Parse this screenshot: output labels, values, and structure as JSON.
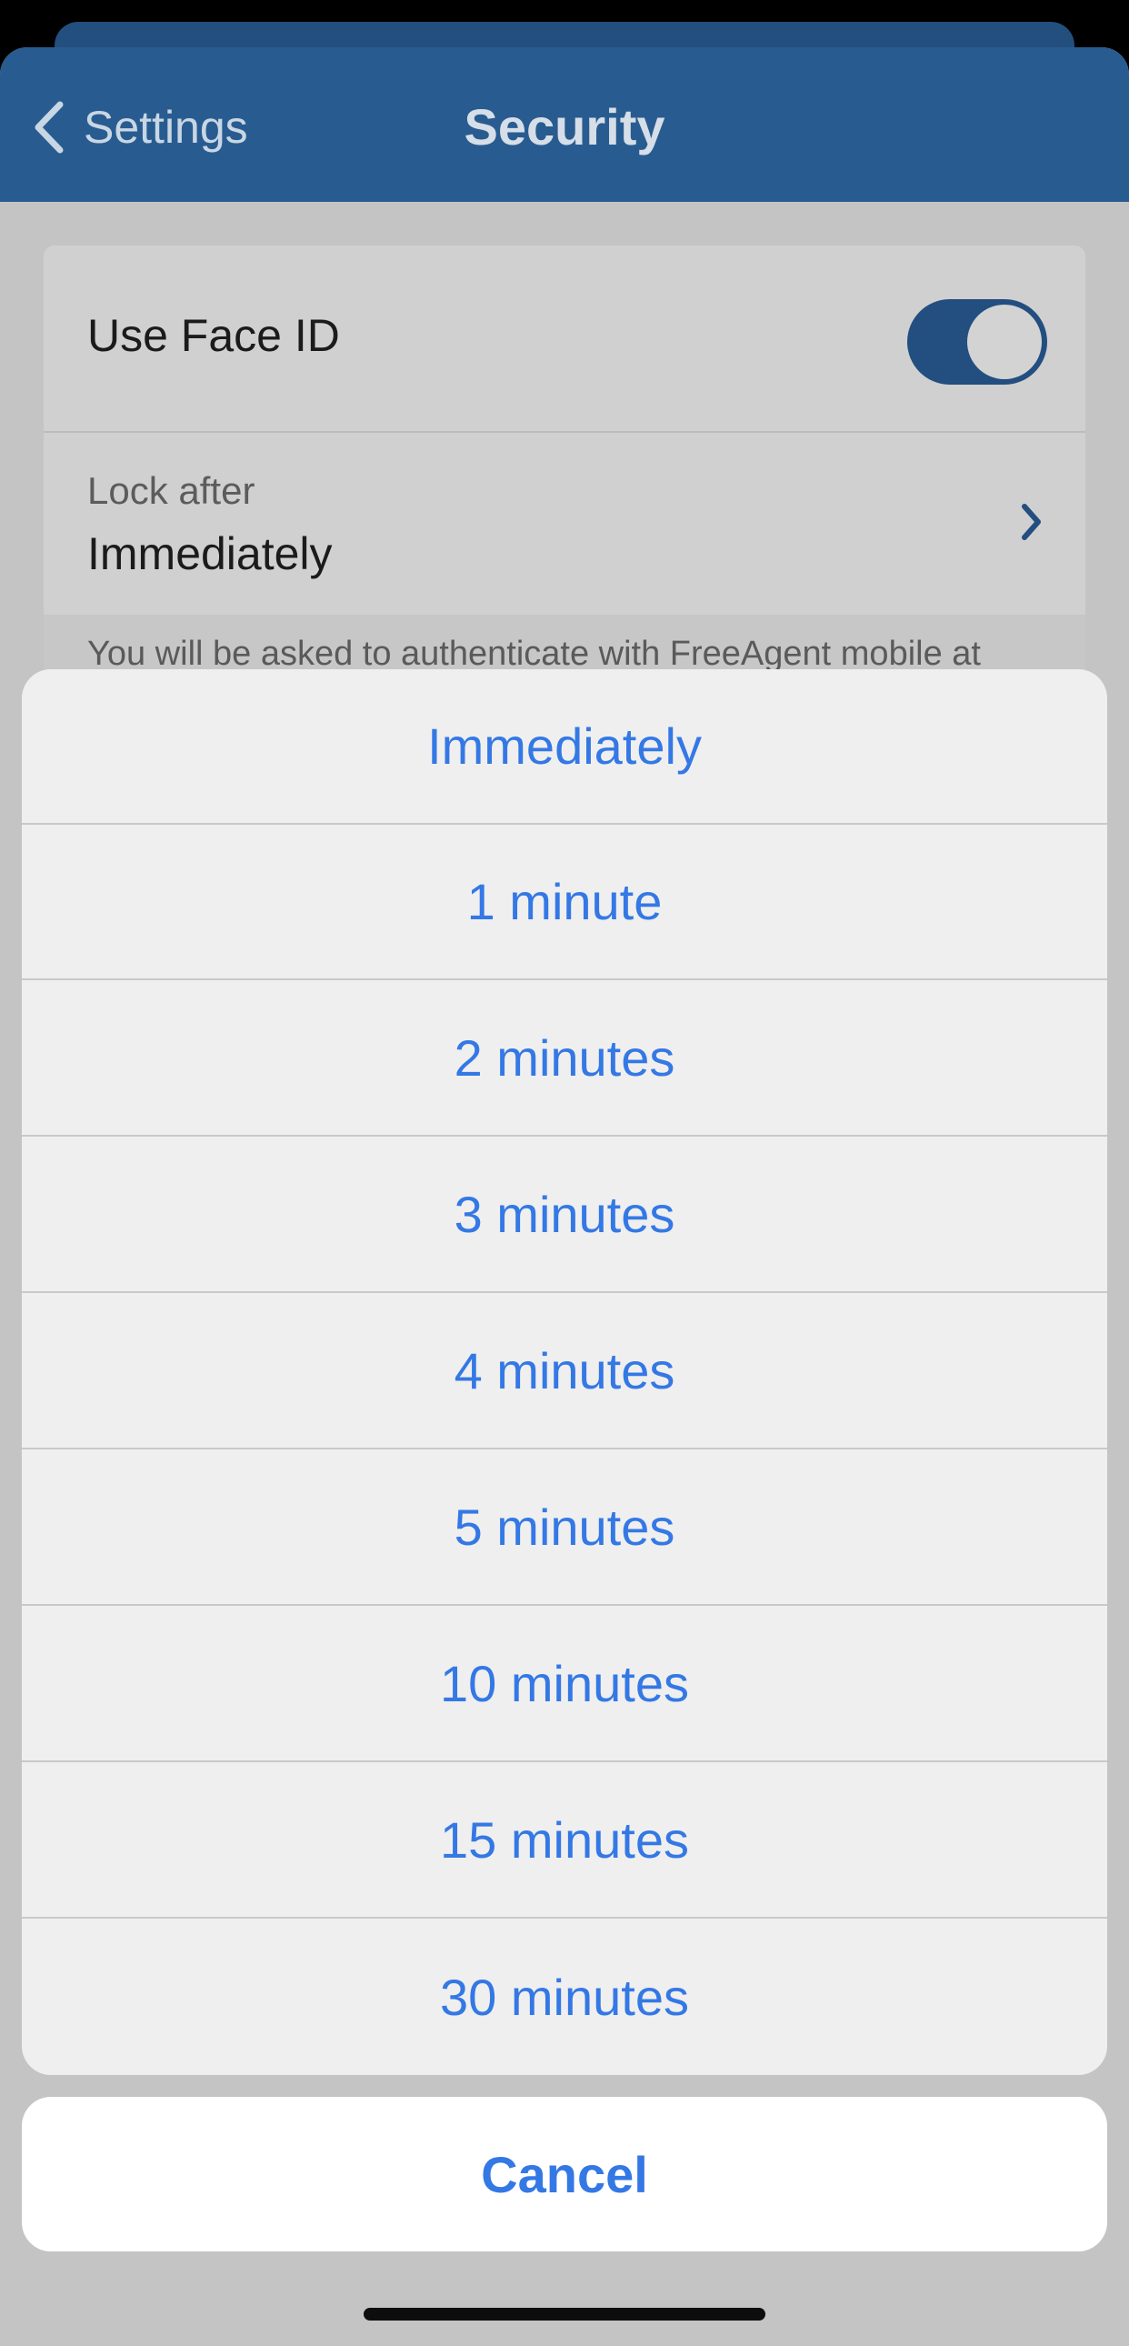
{
  "nav": {
    "back_label": "Settings",
    "title": "Security"
  },
  "settings": {
    "face_id_label": "Use Face ID",
    "face_id_enabled": true,
    "lock_after_caption": "Lock after",
    "lock_after_value": "Immediately",
    "footnote": "You will be asked to authenticate with FreeAgent mobile at"
  },
  "action_sheet": {
    "options": [
      {
        "label": "Immediately"
      },
      {
        "label": "1 minute"
      },
      {
        "label": "2 minutes"
      },
      {
        "label": "3 minutes"
      },
      {
        "label": "4 minutes"
      },
      {
        "label": "5 minutes"
      },
      {
        "label": "10 minutes"
      },
      {
        "label": "15 minutes"
      },
      {
        "label": "30 minutes"
      }
    ],
    "cancel_label": "Cancel"
  },
  "colors": {
    "accent": "#3478e5",
    "navbar": "#285c91",
    "toggle_on": "#234e80",
    "sheet_background": "#efefef",
    "dimmed_background": "#c4c4c5"
  },
  "icons": {
    "back": "chevron-left-icon",
    "disclosure": "chevron-right-icon"
  }
}
